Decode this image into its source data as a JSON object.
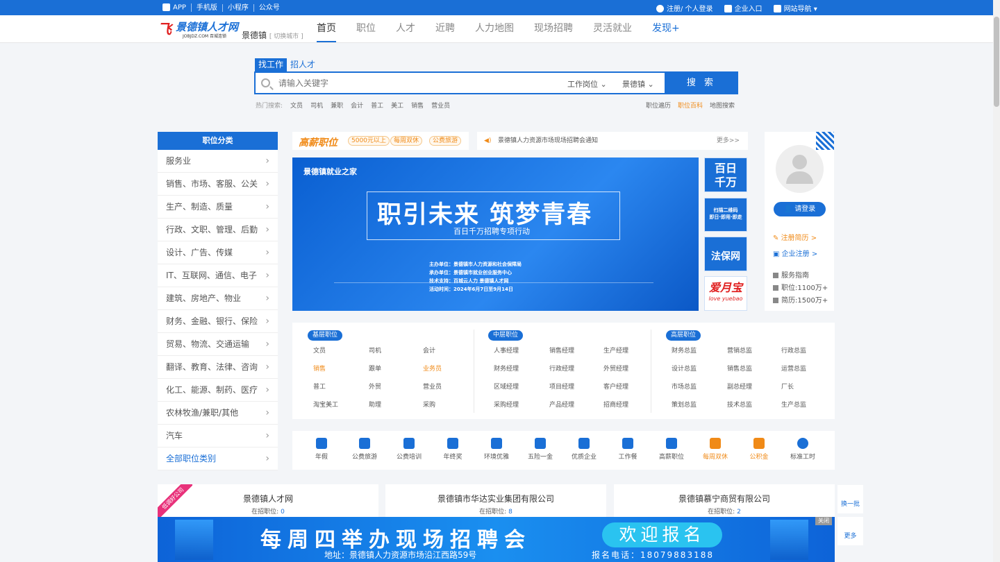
{
  "topbar": {
    "links": [
      "APP",
      "手机版",
      "小程序",
      "公众号"
    ],
    "login": "注册/ 个人登录",
    "enterprise": "企业入口",
    "sitenav": "网站导航"
  },
  "header": {
    "logo_title": "景德镇人才网",
    "logo_sub": "JOBJDZ.COM 百城连锁",
    "city": "景德镇",
    "switch_city": "[ 切换城市 ]",
    "nav": [
      "首页",
      "职位",
      "人才",
      "近聘",
      "人力地图",
      "现场招聘",
      "灵活就业",
      "发现+"
    ]
  },
  "search": {
    "tabs": [
      "找工作",
      "招人才"
    ],
    "placeholder": "请输入关键字",
    "dd_position": "工作岗位",
    "dd_city": "景德镇",
    "button": "搜 索",
    "hot_label": "热门搜索:",
    "hot": [
      "文员",
      "司机",
      "兼职",
      "会计",
      "普工",
      "美工",
      "销售",
      "营业员"
    ],
    "right_links": [
      "职位遍历",
      "职位百科",
      "地图搜索"
    ]
  },
  "category": {
    "header": "职位分类",
    "items": [
      "服务业",
      "销售、市场、客服、公关",
      "生产、制造、质量",
      "行政、文职、管理、后勤",
      "设计、广告、传媒",
      "IT、互联网、通信、电子",
      "建筑、房地产、物业",
      "财务、金融、银行、保险",
      "贸易、物流、交通运输",
      "翻译、教育、法律、咨询",
      "化工、能源、制药、医疗",
      "农林牧渔/兼职/其他",
      "汽车"
    ],
    "all": "全部职位类别"
  },
  "highpay": {
    "logo": "高薪职位",
    "tags": [
      "5000元以上",
      "每周双休",
      "公费旅游"
    ]
  },
  "notice": {
    "text": "景德镇人力资源市场现场招聘会通知",
    "more": "更多>>"
  },
  "banner": {
    "brand": "景德镇就业之家",
    "headline": "职引未来  筑梦青春",
    "sub": "百日千万招聘专项行动",
    "info": [
      "主办单位：景德镇市人力资源和社会保障局",
      "承办单位：景德镇市就业创业服务中心",
      "技术支持：百城云人力  景德镇人才网",
      "活动时间：2024年6月7日至9月14日"
    ]
  },
  "ads": {
    "a1": [
      "百日",
      "千万"
    ],
    "a2": [
      "扫描二维码",
      "即日·即用·即走"
    ],
    "a3": "法保网",
    "a4": "爱月宝",
    "a4_sub": "love yuebao"
  },
  "side": {
    "login": "请登录",
    "resume": "注册简历 >",
    "company": "企业注册 >",
    "guide": "服务指南",
    "jobs": "职位:1100万+",
    "resumes": "简历:1500万+"
  },
  "levels": [
    {
      "tag": "基层职位",
      "items": [
        "文员",
        "司机",
        "会计",
        "销售",
        "跟单",
        "业务员",
        "普工",
        "外贸",
        "营业员",
        "淘宝美工",
        "助理",
        "采购"
      ]
    },
    {
      "tag": "中层职位",
      "items": [
        "人事经理",
        "销售经理",
        "生产经理",
        "财务经理",
        "行政经理",
        "外贸经理",
        "区域经理",
        "项目经理",
        "客户经理",
        "采购经理",
        "产品经理",
        "招商经理"
      ]
    },
    {
      "tag": "高层职位",
      "items": [
        "财务总监",
        "营销总监",
        "行政总监",
        "设计总监",
        "销售总监",
        "运营总监",
        "市场总监",
        "副总经理",
        "厂长",
        "策划总监",
        "技术总监",
        "生产总监"
      ]
    }
  ],
  "welfare": [
    "年假",
    "公费旅游",
    "公费培训",
    "年终奖",
    "环境优雅",
    "五险一金",
    "优质企业",
    "工作餐",
    "高薪职位",
    "每周双休",
    "公积金",
    "标准工时"
  ],
  "companies": [
    {
      "name": "景德镇人才网",
      "label": "在招职位:",
      "count": "0"
    },
    {
      "name": "景德镇市华达实业集团有限公司",
      "label": "在招职位:",
      "count": "8"
    },
    {
      "name": "景德镇慕宁商贸有限公司",
      "label": "在招职位:",
      "count": "2"
    }
  ],
  "ribbon": "低调好公司",
  "rightbtns": [
    "换一批",
    "更多"
  ],
  "bottomad": {
    "title": "每周四举办现场招聘会",
    "welcome": "欢迎报名",
    "address": "地址：景德镇人力资源市场沿江西路59号",
    "phone": "报名电话：18079883188",
    "close": "关闭"
  }
}
